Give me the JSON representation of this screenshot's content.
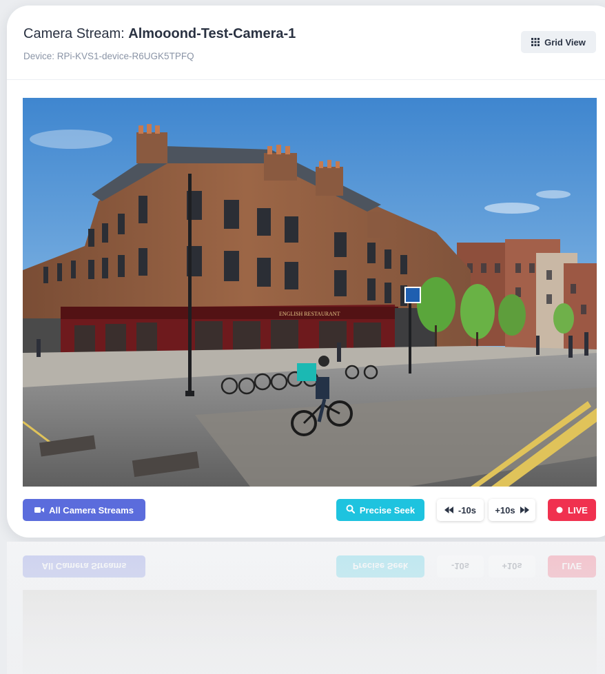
{
  "header": {
    "title_prefix": "Camera Stream: ",
    "camera_name": "Almooond-Test-Camera-1",
    "device_line": "Device: RPi-KVS1-device-R6UGK5TPFQ",
    "grid_view_label": "Grid View"
  },
  "video": {
    "signs": {
      "pub_sign": "ENGLISH RESTAURANT"
    }
  },
  "controls": {
    "all_streams_label": "All Camera Streams",
    "precise_seek_label": "Precise Seek",
    "back_label": "-10s",
    "forward_label": "+10s",
    "live_label": "LIVE"
  },
  "colors": {
    "primary": "#5b6cdc",
    "info": "#1ec3df",
    "danger": "#f0314f",
    "title_text": "#2a3242",
    "muted_text": "#8a94a6"
  },
  "icons": {
    "grid": "grid-icon",
    "camera": "video-camera-icon",
    "search": "search-icon",
    "rewind": "rewind-icon",
    "fast_forward": "fast-forward-icon",
    "live_dot": "record-dot-icon"
  }
}
